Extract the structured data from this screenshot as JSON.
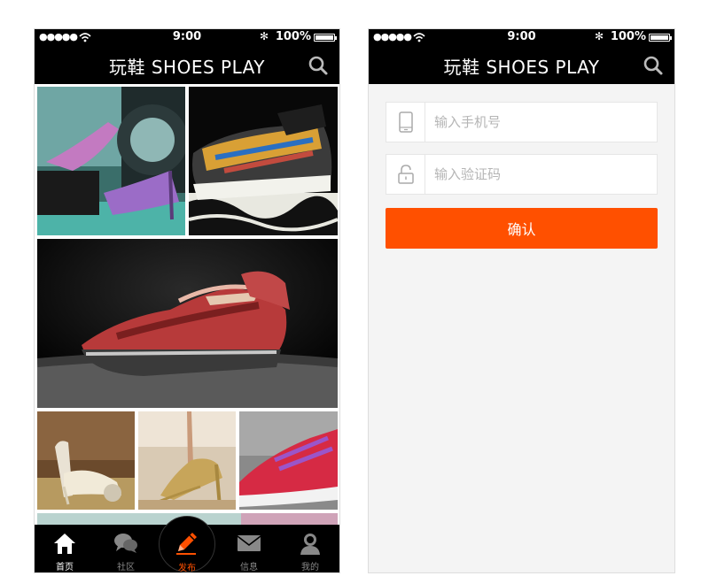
{
  "status_bar": {
    "signal": "●●●●●",
    "time": "9:00",
    "bluetooth": "✻",
    "battery": "100%"
  },
  "navbar": {
    "title": "玩鞋 SHOES PLAY",
    "search_icon": "search-icon"
  },
  "tabbar": {
    "tabs": [
      {
        "label": "首页",
        "icon": "home-icon"
      },
      {
        "label": "社区",
        "icon": "chat-bubbles-icon"
      },
      {
        "label": "发布",
        "icon": "pencil-icon"
      },
      {
        "label": "信息",
        "icon": "envelope-icon"
      },
      {
        "label": "我的",
        "icon": "user-icon"
      }
    ]
  },
  "login": {
    "phone_placeholder": "输入手机号",
    "code_placeholder": "输入验证码",
    "confirm_label": "确认"
  },
  "colors": {
    "accent": "#ff5000",
    "bar": "#000000",
    "form_background": "#f4f4f4"
  }
}
